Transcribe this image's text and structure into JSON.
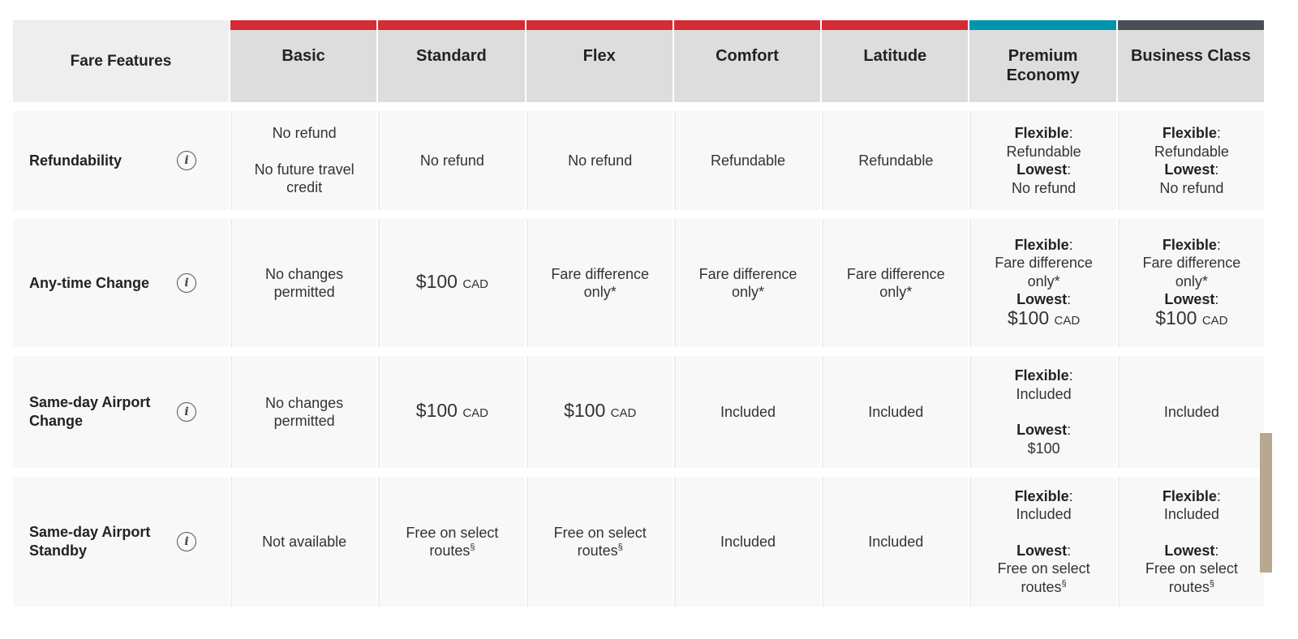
{
  "header": {
    "label": "Fare Features",
    "columns": [
      {
        "name": "Basic",
        "accent": "#d52b34"
      },
      {
        "name": "Standard",
        "accent": "#d52b34"
      },
      {
        "name": "Flex",
        "accent": "#d52b34"
      },
      {
        "name": "Comfort",
        "accent": "#d52b34"
      },
      {
        "name": "Latitude",
        "accent": "#d52b34"
      },
      {
        "name": "Premium Economy",
        "accent": "#0093ad"
      },
      {
        "name": "Business Class",
        "accent": "#4a4f56"
      }
    ]
  },
  "common": {
    "flexible": "Flexible",
    "lowest": "Lowest",
    "colon": ":",
    "currency": "CAD",
    "section": "§",
    "info_icon": "i"
  },
  "rows": [
    {
      "feature": "Refundability",
      "cells": {
        "basic": {
          "line1": "No refund",
          "line2": "No future travel credit"
        },
        "standard": "No refund",
        "flex": "No refund",
        "comfort": "Refundable",
        "latitude": "Refundable",
        "premium": {
          "flexible": "Refundable",
          "lowest": "No refund"
        },
        "business": {
          "flexible": "Refundable",
          "lowest": "No refund"
        }
      }
    },
    {
      "feature": "Any-time Change",
      "cells": {
        "basic": "No changes permitted",
        "standard": "$100",
        "flex": "Fare difference only*",
        "comfort": "Fare difference only*",
        "latitude": "Fare difference only*",
        "premium": {
          "flexible": "Fare difference only*",
          "lowest": "$100"
        },
        "business": {
          "flexible": "Fare difference only*",
          "lowest": "$100"
        }
      }
    },
    {
      "feature": "Same-day Airport Change",
      "cells": {
        "basic": "No changes permitted",
        "standard": "$100",
        "flex": "$100",
        "comfort": "Included",
        "latitude": "Included",
        "premium": {
          "flexible": "Included",
          "lowest": "$100"
        },
        "business": "Included"
      }
    },
    {
      "feature": "Same-day Airport Standby",
      "cells": {
        "basic": "Not available",
        "standard": "Free on select routes",
        "flex": "Free on select routes",
        "comfort": "Included",
        "latitude": "Included",
        "premium": {
          "flexible": "Included",
          "lowest": "Free on select routes"
        },
        "business": {
          "flexible": "Included",
          "lowest": "Free on select routes"
        }
      }
    }
  ]
}
